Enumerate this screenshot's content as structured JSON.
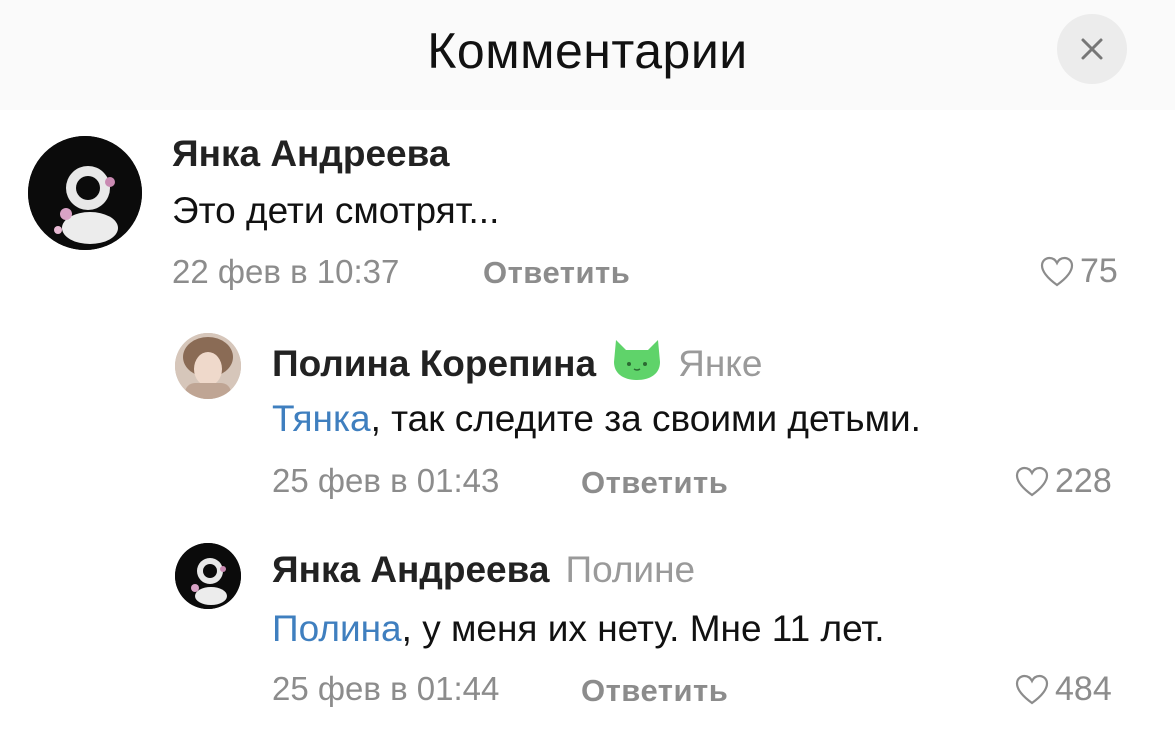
{
  "header": {
    "title": "Комментарии",
    "close_icon": "close-icon"
  },
  "comments": [
    {
      "author": "Янка Андреева",
      "addressee": "",
      "mention": "",
      "text": "Это дети смотрят...",
      "date": "22 фев в 10:37",
      "reply_label": "Ответить",
      "likes": "75"
    },
    {
      "author": "Полина Корепина",
      "addressee": "Янке",
      "mention": "Тянка",
      "text": ", так следите за своими детьми.",
      "date": "25 фев в 01:43",
      "reply_label": "Ответить",
      "likes": "228"
    },
    {
      "author": "Янка Андреева",
      "addressee": "Полине",
      "mention": "Полина",
      "text": ", у меня их нету. Мне 11 лет.",
      "date": "25 фев в 01:44",
      "reply_label": "Ответить",
      "likes": "484"
    }
  ],
  "colors": {
    "mention": "#3f7fbf",
    "meta": "#8c8c8c",
    "badge": "#5fd36a"
  }
}
